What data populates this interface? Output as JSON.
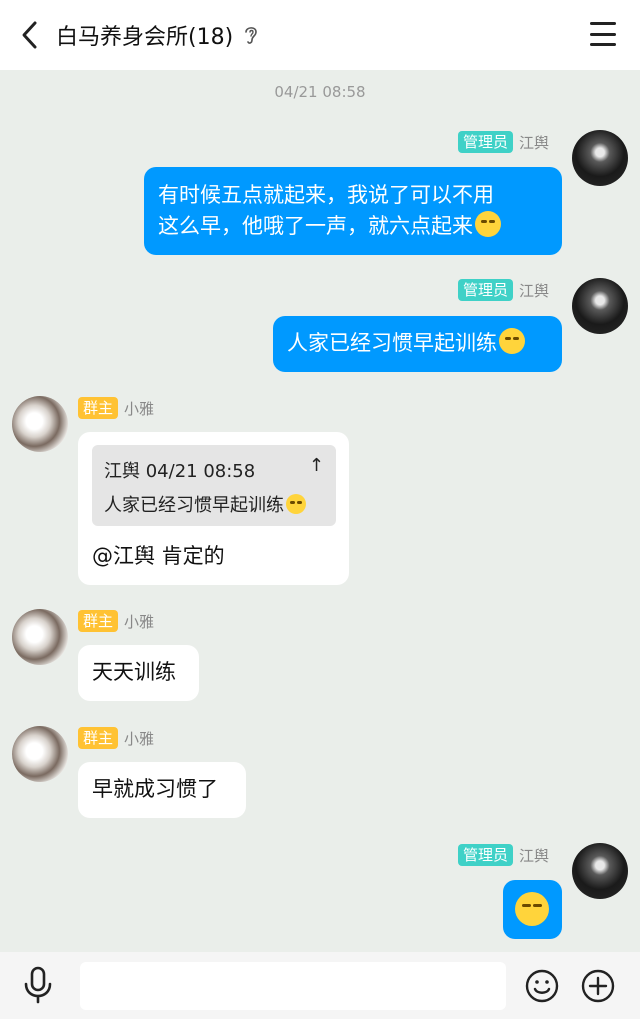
{
  "header": {
    "title": "白马养身会所(18)",
    "back_icon": "chevron-left-icon",
    "ear_icon": "ear-icon",
    "menu_icon": "hamburger-menu-icon"
  },
  "timestamp": "04/21 08:58",
  "messages": [
    {
      "sender": "江舆",
      "role": "管理员",
      "text": "有时候五点就起来，我说了可以不用",
      "text2": "这么早，他哦了一声，就六点起来"
    },
    {
      "sender": "江舆",
      "role": "管理员",
      "text": "人家已经习惯早起训练"
    },
    {
      "sender": "小雅",
      "role": "群主",
      "quote_head": "江舆 04/21 08:58",
      "quote_arrow": "↑",
      "quote_body": "人家已经习惯早起训练",
      "text": "@江舆 肯定的"
    },
    {
      "sender": "小雅",
      "role": "群主",
      "text": "天天训练"
    },
    {
      "sender": "小雅",
      "role": "群主",
      "text": "早就成习惯了"
    },
    {
      "sender": "江舆",
      "role": "管理员",
      "emoji": "smirk-emoji"
    }
  ],
  "bottom": {
    "mic_icon": "microphone-icon",
    "input_placeholder": "",
    "emoji_icon": "smiley-icon",
    "plus_icon": "plus-circle-icon"
  },
  "colors": {
    "bubble_blue": "#0099ff",
    "badge_admin": "#3fd1c7",
    "badge_owner": "#ffc233",
    "background": "#eaeeea"
  }
}
